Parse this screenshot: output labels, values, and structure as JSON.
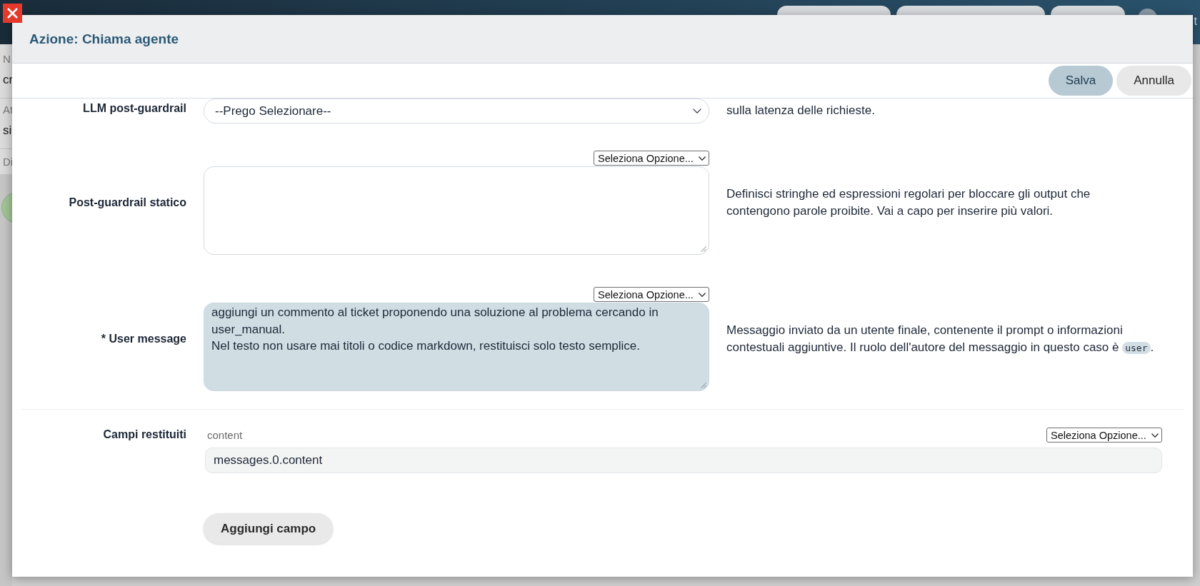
{
  "background": {
    "header_fragment": "t",
    "sidebar_groups": [
      {
        "label": "N",
        "value": "cr"
      },
      {
        "label": "At",
        "value": "si"
      },
      {
        "label": "Di"
      }
    ]
  },
  "modal": {
    "title": "Azione: Chiama agente",
    "buttons": [
      {
        "label": "Salva",
        "kind": "primary"
      },
      {
        "label": "Annulla",
        "kind": "secondary"
      }
    ]
  },
  "fields": [
    {
      "kind": "select",
      "label": "LLM post-guardrail",
      "value": "--Prego Selezionare--",
      "description": [
        {
          "kind": "text",
          "text": "sulla latenza delle richieste."
        }
      ]
    },
    {
      "kind": "textarea",
      "label": "Post-guardrail statico",
      "option_select": "Seleziona Opzione...",
      "highlighted": false,
      "description": [
        {
          "kind": "text",
          "text": "Definisci stringhe ed espressioni regolari per bloccare gli output che contengono parole proibite. Vai a capo per inserire più valori."
        }
      ]
    },
    {
      "kind": "textarea",
      "label": "* User message",
      "option_select": "Seleziona Opzione...",
      "highlighted": true,
      "value": "aggiungi un commento al ticket proponendo una soluzione al problema cercando in user_manual.\nNel testo non usare mai titoli o codice markdown, restituisci solo testo semplice.",
      "description": [
        {
          "kind": "text",
          "text": "Messaggio inviato da un utente finale, contenente il prompt o informazioni contestuali aggiuntive. Il ruolo dell'autore del messaggio in questo caso è "
        },
        {
          "kind": "code",
          "text": "user"
        },
        {
          "kind": "text",
          "text": "."
        }
      ]
    }
  ],
  "returned_fields": {
    "label": "Campi restituiti",
    "items": [
      {
        "name": "content",
        "option_select": "Seleziona Opzione...",
        "value": "messages.0.content"
      }
    ],
    "add_button": "Aggiungi campo"
  }
}
